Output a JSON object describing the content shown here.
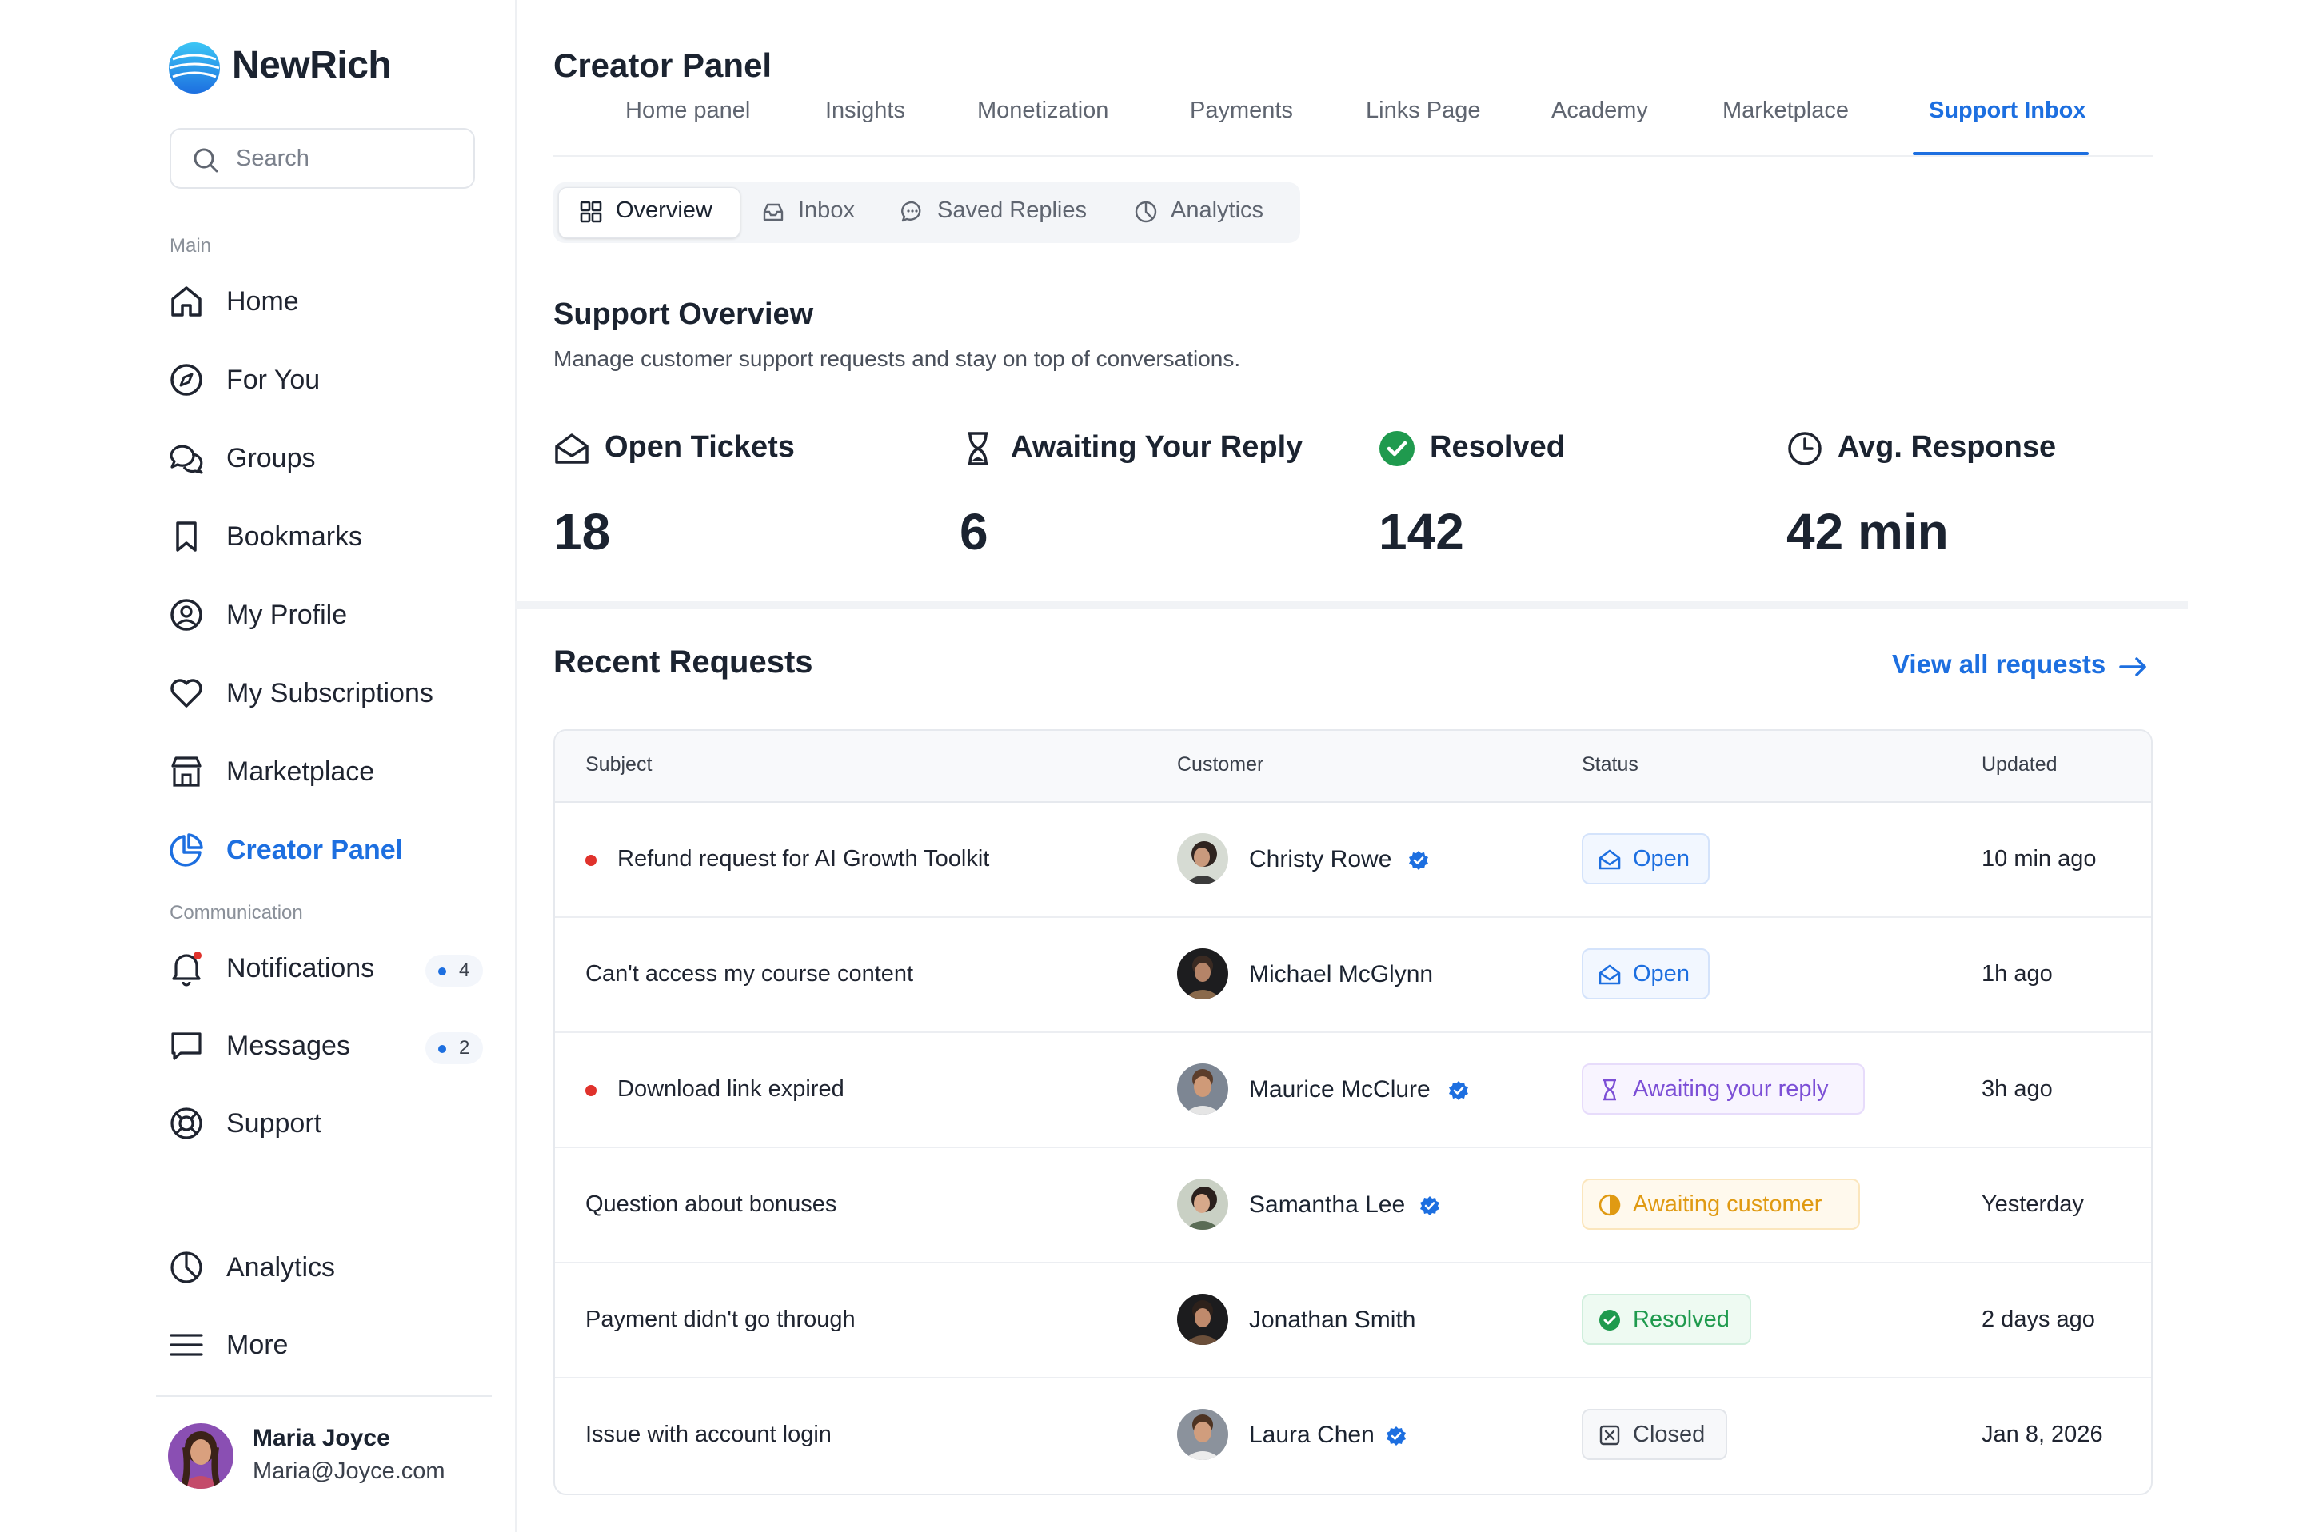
{
  "brand": {
    "name": "NewRich"
  },
  "search": {
    "placeholder": "Search"
  },
  "sidebar": {
    "section_main": "Main",
    "main_items": [
      {
        "label": "Home",
        "icon": "home-icon"
      },
      {
        "label": "For You",
        "icon": "compass-icon"
      },
      {
        "label": "Groups",
        "icon": "chat-bubbles-icon"
      },
      {
        "label": "Bookmarks",
        "icon": "bookmark-icon"
      },
      {
        "label": "My Profile",
        "icon": "user-circle-icon"
      },
      {
        "label": "My Subscriptions",
        "icon": "heart-icon"
      },
      {
        "label": "Marketplace",
        "icon": "store-icon"
      },
      {
        "label": "Creator Panel",
        "icon": "pie-chart-icon",
        "active": true
      }
    ],
    "section_communication": "Communication",
    "comm_items": [
      {
        "label": "Notifications",
        "icon": "bell-icon",
        "badge": "4"
      },
      {
        "label": "Messages",
        "icon": "message-icon",
        "badge": "2"
      },
      {
        "label": "Support",
        "icon": "lifebuoy-icon"
      }
    ],
    "bottom_items": [
      {
        "label": "Analytics",
        "icon": "pie-chart-icon"
      },
      {
        "label": "More",
        "icon": "menu-icon"
      }
    ],
    "user": {
      "name": "Maria Joyce",
      "email": "Maria@Joyce.com"
    }
  },
  "header": {
    "title": "Creator Panel",
    "tabs": [
      "Home panel",
      "Insights",
      "Monetization",
      "Payments",
      "Links Page",
      "Academy",
      "Marketplace",
      "Support Inbox"
    ],
    "active_tab": "Support Inbox"
  },
  "subtabs": {
    "items": [
      {
        "label": "Overview",
        "icon": "grid-icon"
      },
      {
        "label": "Inbox",
        "icon": "inbox-icon"
      },
      {
        "label": "Saved Replies",
        "icon": "chat-dots-icon"
      },
      {
        "label": "Analytics",
        "icon": "pie-chart-icon"
      }
    ],
    "active": "Overview"
  },
  "overview": {
    "title": "Support Overview",
    "subtitle": "Manage customer support requests and stay on top of conversations.",
    "stats": [
      {
        "label": "Open Tickets",
        "value": "18",
        "icon": "envelope-open-icon"
      },
      {
        "label": "Awaiting Your Reply",
        "value": "6",
        "icon": "hourglass-icon"
      },
      {
        "label": "Resolved",
        "value": "142",
        "icon": "check-circle-icon"
      },
      {
        "label": "Avg. Response",
        "value": "42 min",
        "icon": "clock-icon"
      }
    ]
  },
  "requests": {
    "title": "Recent Requests",
    "view_all": "View all requests",
    "columns": [
      "Subject",
      "Customer",
      "Status",
      "Updated"
    ],
    "rows": [
      {
        "subject": "Refund request for AI Growth Toolkit",
        "unread": true,
        "customer": "Christy Rowe",
        "verified": true,
        "status": "Open",
        "updated": "10 min ago"
      },
      {
        "subject": "Can't access my course content",
        "unread": false,
        "customer": "Michael McGlynn",
        "verified": false,
        "status": "Open",
        "updated": "1h ago"
      },
      {
        "subject": "Download link expired",
        "unread": true,
        "customer": "Maurice McClure",
        "verified": true,
        "status": "Awaiting your reply",
        "updated": "3h ago"
      },
      {
        "subject": "Question about bonuses",
        "unread": false,
        "customer": "Samantha Lee",
        "verified": true,
        "status": "Awaiting customer",
        "updated": "Yesterday"
      },
      {
        "subject": "Payment didn't go through",
        "unread": false,
        "customer": "Jonathan Smith",
        "verified": false,
        "status": "Resolved",
        "updated": "2 days ago"
      },
      {
        "subject": "Issue with account login",
        "unread": false,
        "customer": "Laura Chen",
        "verified": true,
        "status": "Closed",
        "updated": "Jan 8, 2026"
      }
    ]
  },
  "colors": {
    "accent": "#1d6fe0",
    "unread_dot": "#e0322c",
    "status_open": "#1d6fe0",
    "status_awaiting_reply": "#7c4fd6",
    "status_awaiting_customer": "#e09a12",
    "status_resolved": "#1f9a4e",
    "status_closed": "#3a404b"
  }
}
